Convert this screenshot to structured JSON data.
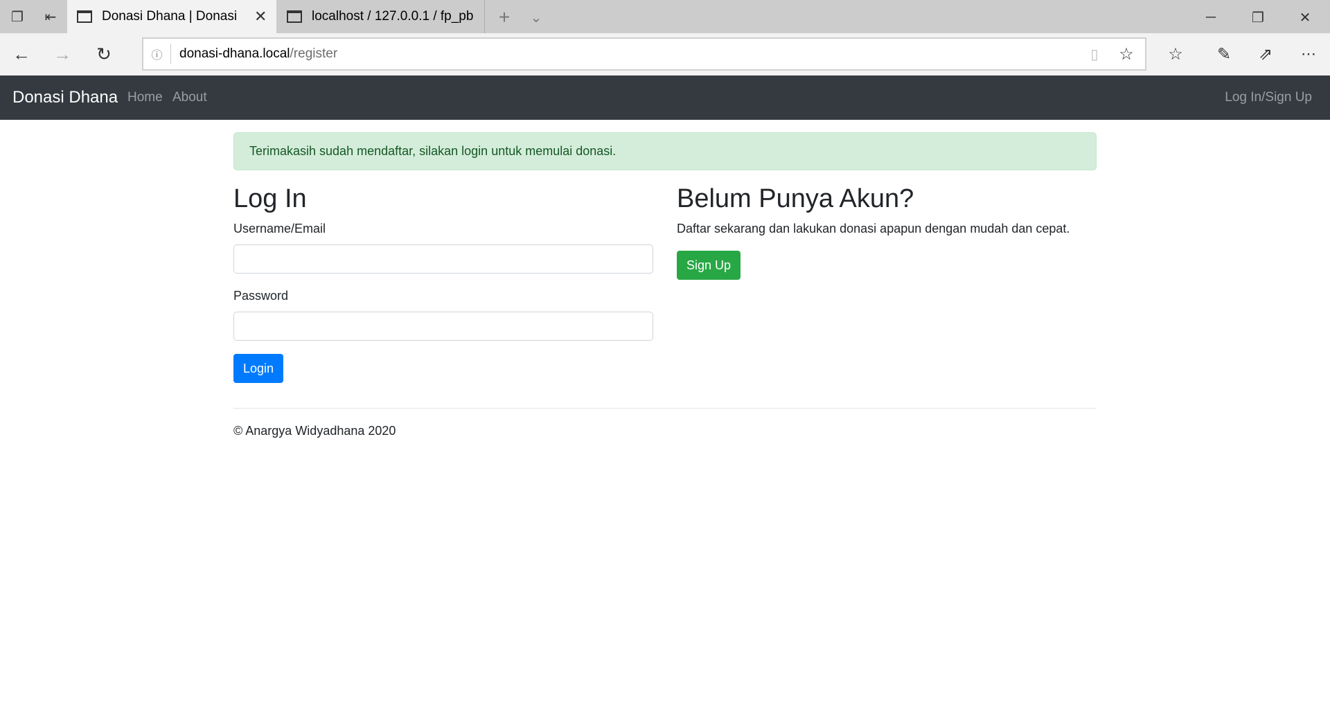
{
  "browser": {
    "tabs": [
      {
        "title": "Donasi Dhana | Donasi D",
        "active": true
      },
      {
        "title": "localhost / 127.0.0.1 / fp_pb",
        "active": false
      }
    ],
    "url_host": "donasi-dhana.local",
    "url_path": "/register"
  },
  "navbar": {
    "brand": "Donasi Dhana",
    "links": [
      "Home",
      "About"
    ],
    "right_link": "Log In/Sign Up"
  },
  "alert": {
    "message": "Terimakasih sudah mendaftar, silakan login untuk memulai donasi.",
    "color": "#d4edda"
  },
  "login": {
    "title": "Log In",
    "username_label": "Username/Email",
    "username_value": "",
    "password_label": "Password",
    "password_value": "",
    "button": "Login",
    "button_color": "#007bff"
  },
  "signup": {
    "title": "Belum Punya Akun?",
    "text": "Daftar sekarang dan lakukan donasi apapun dengan mudah dan cepat.",
    "button": "Sign Up",
    "button_color": "#28a745"
  },
  "footer": {
    "text": "© Anargya Widyadhana 2020"
  }
}
